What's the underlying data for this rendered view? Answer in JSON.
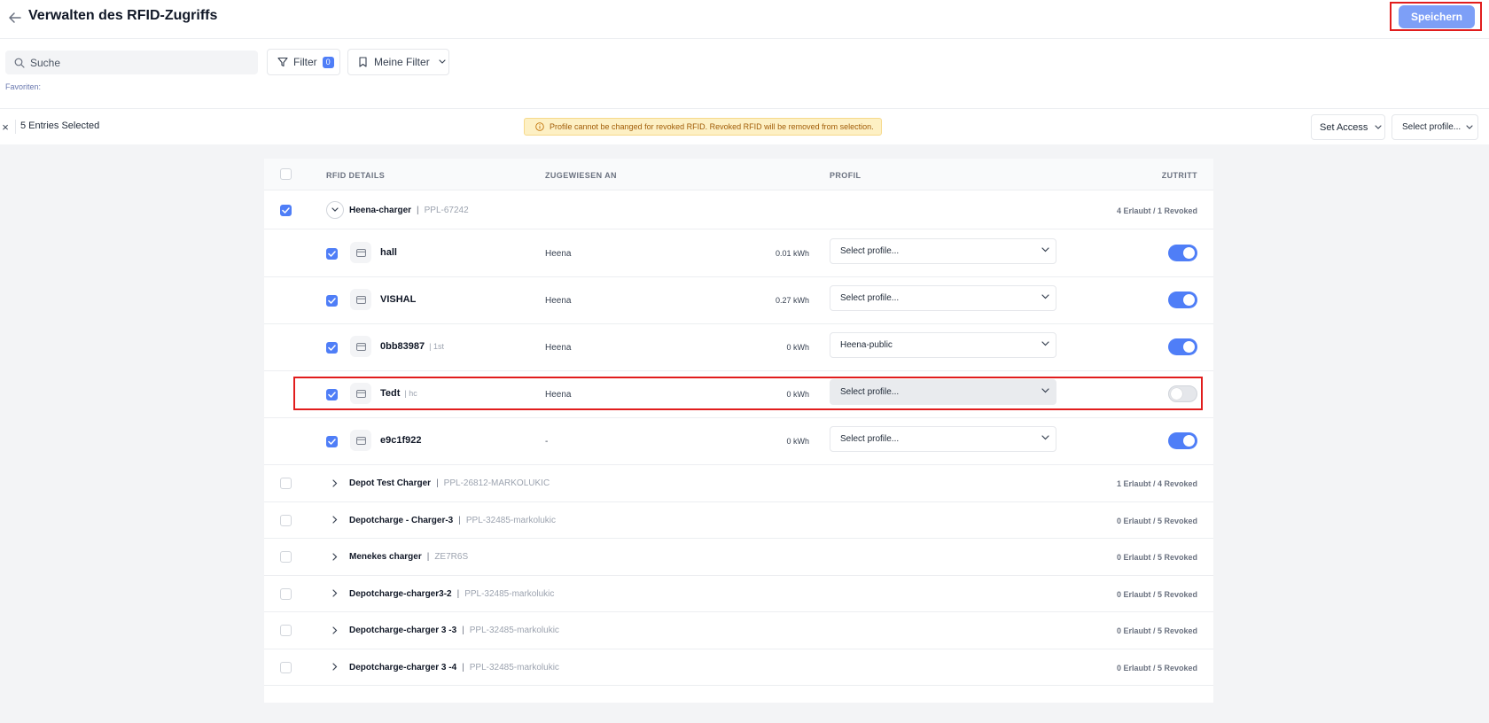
{
  "header": {
    "title": "Verwalten des RFID-Zugriffs",
    "save_label": "Speichern"
  },
  "filters": {
    "search_placeholder": "Suche",
    "filter_label": "Filter",
    "filter_count": "0",
    "my_filter_label": "Meine Filter",
    "favorites_label": "Favoriten:"
  },
  "selection": {
    "close_glyph": "×",
    "count_label": "5 Entries Selected",
    "warning": "Profile cannot be changed for revoked RFID. Revoked RFID will be removed from selection.",
    "set_access_label": "Set Access",
    "select_profile_label": "Select profile..."
  },
  "table": {
    "columns": {
      "details": "RFID DETAILS",
      "assigned": "ZUGEWIESEN AN",
      "profile": "PROFIL",
      "access": "ZUTRITT"
    },
    "expanded_group": {
      "name": "Heena-charger",
      "id": "PPL-67242",
      "count": "4 Erlaubt / 1 Revoked",
      "checked": true,
      "rows": [
        {
          "name": "hall",
          "sub": "",
          "assigned": "Heena",
          "kwh": "0.01 kWh",
          "profile": "Select profile...",
          "access": true,
          "highlight": false
        },
        {
          "name": "VISHAL",
          "sub": "",
          "assigned": "Heena",
          "kwh": "0.27 kWh",
          "profile": "Select profile...",
          "access": true,
          "highlight": false
        },
        {
          "name": "0bb83987",
          "sub": "1st",
          "assigned": "Heena",
          "kwh": "0 kWh",
          "profile": "Heena-public",
          "access": true,
          "highlight": false
        },
        {
          "name": "Tedt",
          "sub": "hc",
          "assigned": "Heena",
          "kwh": "0 kWh",
          "profile": "Select profile...",
          "access": false,
          "highlight": true
        },
        {
          "name": "e9c1f922",
          "sub": "",
          "assigned": "-",
          "kwh": "0 kWh",
          "profile": "Select profile...",
          "access": true,
          "highlight": false
        }
      ]
    },
    "collapsed_groups": [
      {
        "name": "Depot Test Charger",
        "id": "PPL-26812-MARKOLUKIC",
        "count": "1 Erlaubt / 4 Revoked"
      },
      {
        "name": "Depotcharge - Charger-3",
        "id": "PPL-32485-markolukic",
        "count": "0 Erlaubt / 5 Revoked"
      },
      {
        "name": "Menekes charger",
        "id": "ZE7R6S",
        "count": "0 Erlaubt / 5 Revoked"
      },
      {
        "name": "Depotcharge-charger3-2",
        "id": "PPL-32485-markolukic",
        "count": "0 Erlaubt / 5 Revoked"
      },
      {
        "name": "Depotcharge-charger 3 -3",
        "id": "PPL-32485-markolukic",
        "count": "0 Erlaubt / 5 Revoked"
      },
      {
        "name": "Depotcharge-charger 3 -4",
        "id": "PPL-32485-markolukic",
        "count": "0 Erlaubt / 5 Revoked"
      }
    ]
  },
  "colors": {
    "accent": "#4f7ef7",
    "save_button": "#7d9ff7",
    "highlight_border": "#e11d1d",
    "warning_bg": "#fdf0c4"
  }
}
